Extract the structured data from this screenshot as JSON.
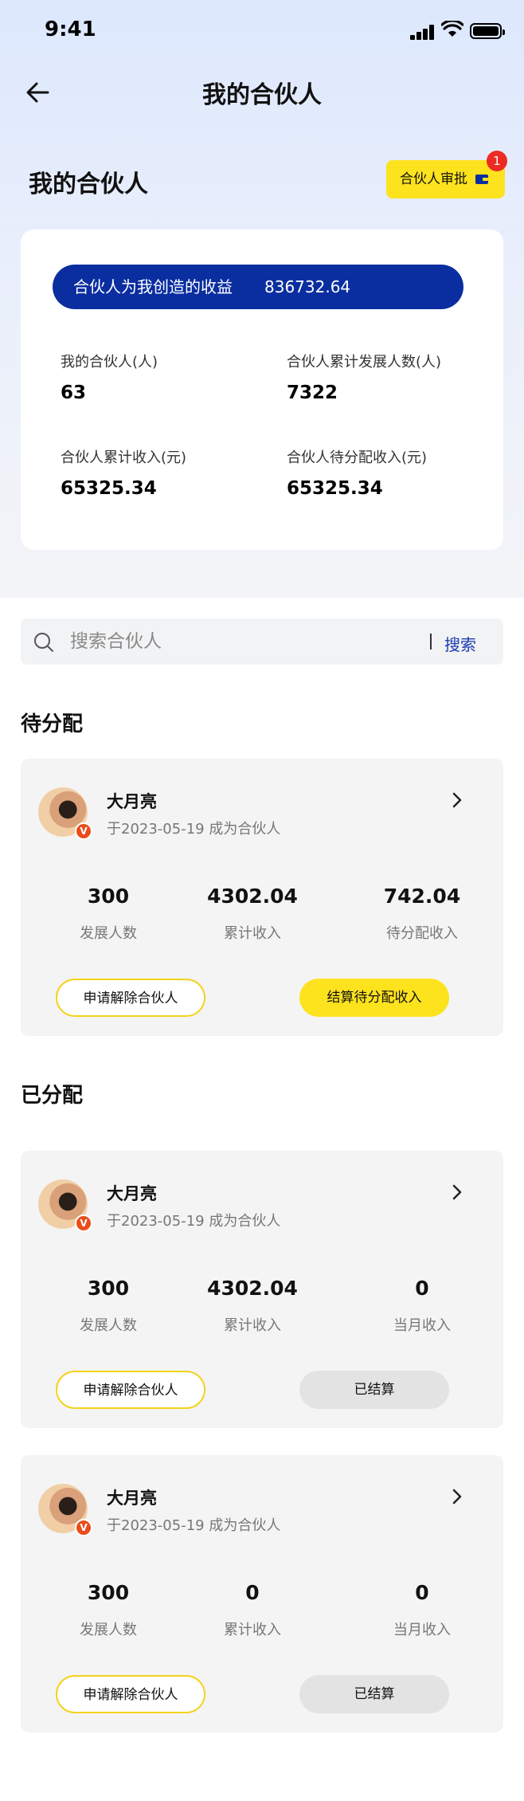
{
  "status_bar": {
    "time": "9:41"
  },
  "nav": {
    "title": "我的合伙人"
  },
  "section": {
    "title": "我的合伙人",
    "approve_label": "合伙人审批",
    "approve_badge": "1"
  },
  "summary": {
    "earnings_label": "合伙人为我创造的收益",
    "earnings_value": "836732.64",
    "stats": [
      {
        "label": "我的合伙人(人)",
        "value": "63"
      },
      {
        "label": "合伙人累计发展人数(人)",
        "value": "7322"
      },
      {
        "label": "合伙人累计收入(元)",
        "value": "65325.34"
      },
      {
        "label": "合伙人待分配收入(元)",
        "value": "65325.34"
      }
    ]
  },
  "search": {
    "placeholder": "搜索合伙人",
    "button": "搜索"
  },
  "pending": {
    "title": "待分配",
    "partners": [
      {
        "name": "大月亮",
        "joined": "于2023-05-19 成为合伙人",
        "metrics": [
          {
            "value": "300",
            "label": "发展人数"
          },
          {
            "value": "4302.04",
            "label": "累计收入"
          },
          {
            "value": "742.04",
            "label": "待分配收入"
          }
        ],
        "btn_remove": "申请解除合伙人",
        "btn_action": "结算待分配收入"
      }
    ]
  },
  "settled": {
    "title": "已分配",
    "partners": [
      {
        "name": "大月亮",
        "joined": "于2023-05-19 成为合伙人",
        "metrics": [
          {
            "value": "300",
            "label": "发展人数"
          },
          {
            "value": "4302.04",
            "label": "累计收入"
          },
          {
            "value": "0",
            "label": "当月收入"
          }
        ],
        "btn_remove": "申请解除合伙人",
        "btn_action": "已结算"
      },
      {
        "name": "大月亮",
        "joined": "于2023-05-19 成为合伙人",
        "metrics": [
          {
            "value": "300",
            "label": "发展人数"
          },
          {
            "value": "0",
            "label": "累计收入"
          },
          {
            "value": "0",
            "label": "当月收入"
          }
        ],
        "btn_remove": "申请解除合伙人",
        "btn_action": "已结算"
      }
    ]
  },
  "colors": {
    "accent_blue": "#0a2ea0",
    "accent_yellow": "#fde21e",
    "badge_red": "#ec2b22"
  }
}
